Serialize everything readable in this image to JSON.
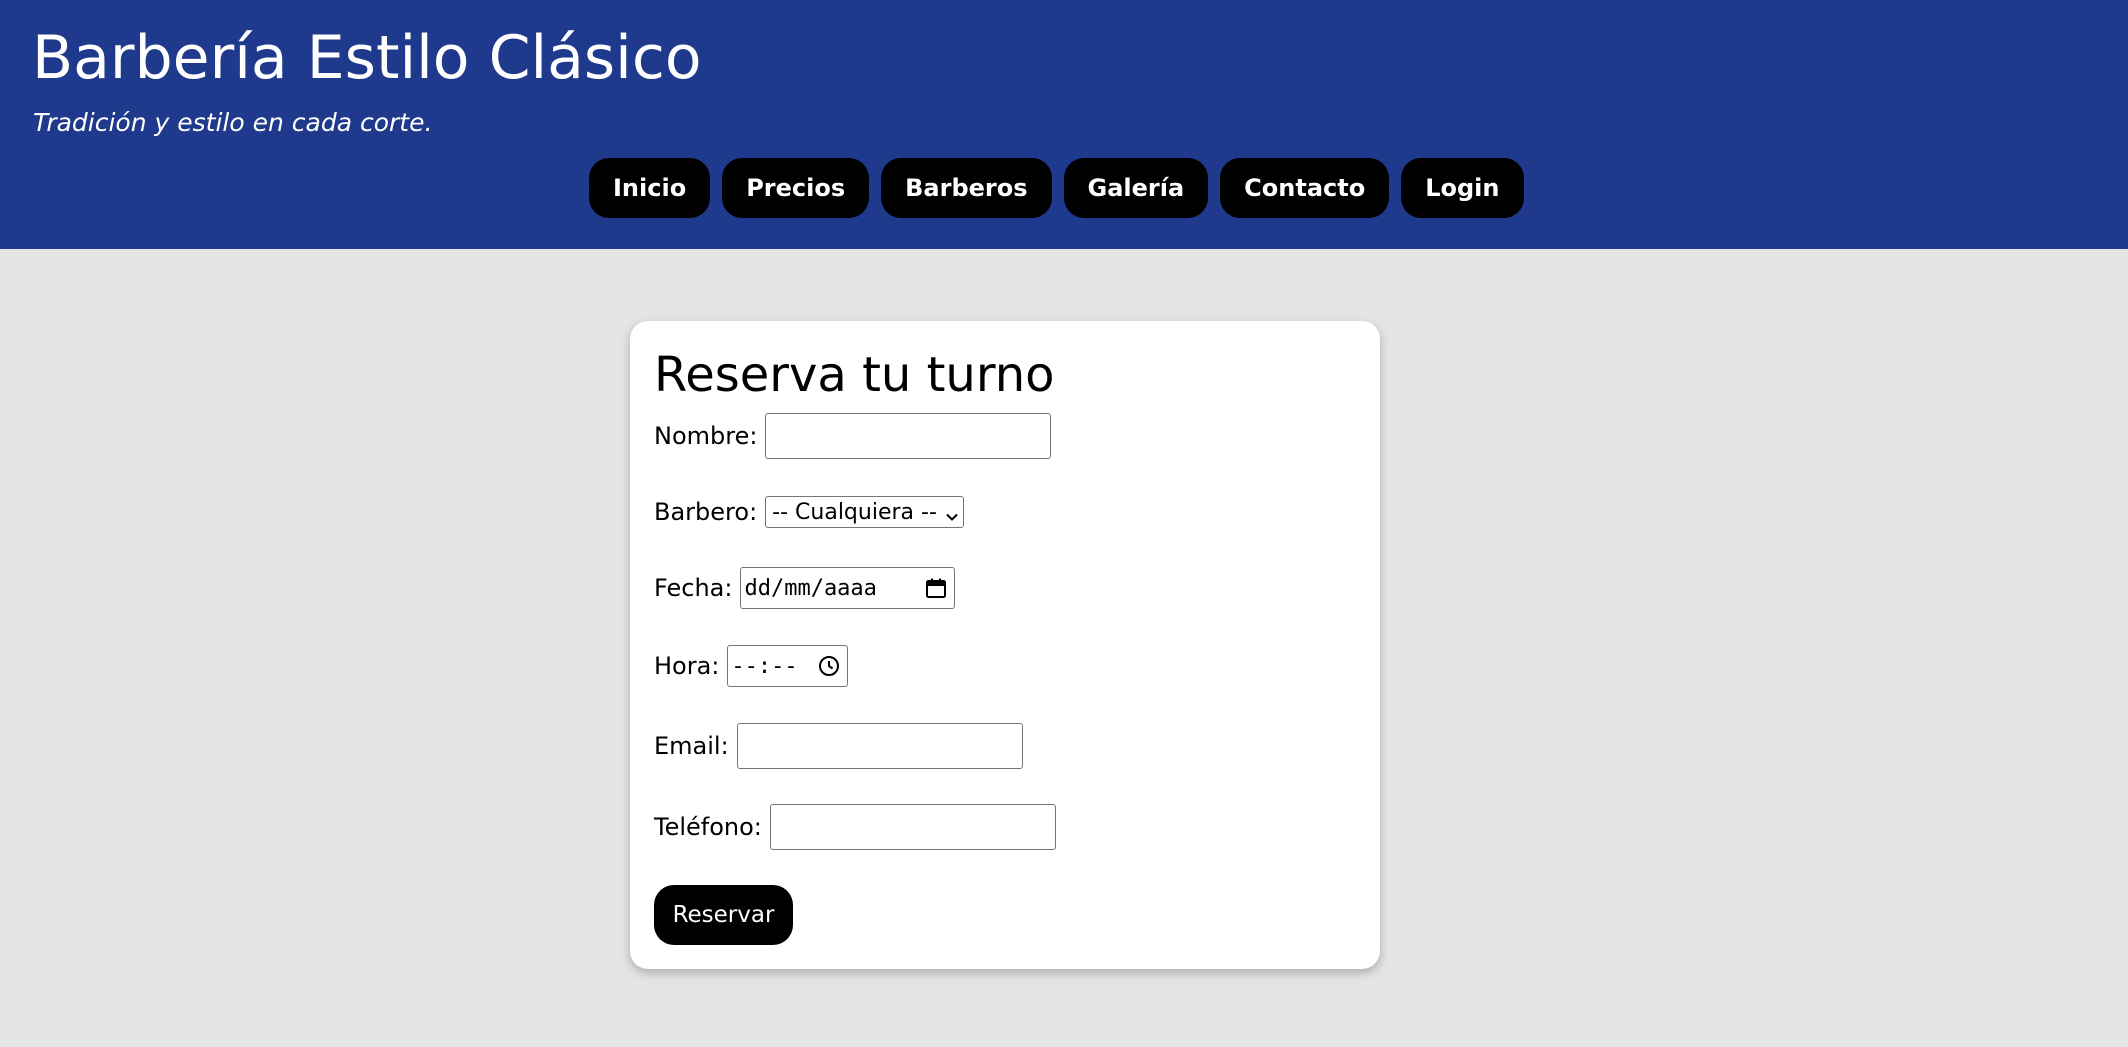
{
  "header": {
    "title": "Barbería Estilo Clásico",
    "tagline": "Tradición y estilo en cada corte.",
    "nav": [
      "Inicio",
      "Precios",
      "Barberos",
      "Galería",
      "Contacto",
      "Login"
    ]
  },
  "form": {
    "title": "Reserva tu turno",
    "fields": {
      "nombre": {
        "label": "Nombre:",
        "value": ""
      },
      "barbero": {
        "label": "Barbero:",
        "selected": "-- Cualquiera --"
      },
      "fecha": {
        "label": "Fecha:",
        "placeholder": "dd/mm/aaaa"
      },
      "hora": {
        "label": "Hora:",
        "placeholder": "--:--"
      },
      "email": {
        "label": "Email:",
        "value": ""
      },
      "telefono": {
        "label": "Teléfono:",
        "value": ""
      }
    },
    "submit_label": "Reservar"
  },
  "colors": {
    "header_bg": "#1f3a8c",
    "page_bg": "#e5e5e5",
    "button_bg": "#000000",
    "button_text": "#ffffff"
  },
  "icons": {
    "select": "chevron-down-icon",
    "date": "calendar-icon",
    "time": "clock-icon"
  }
}
